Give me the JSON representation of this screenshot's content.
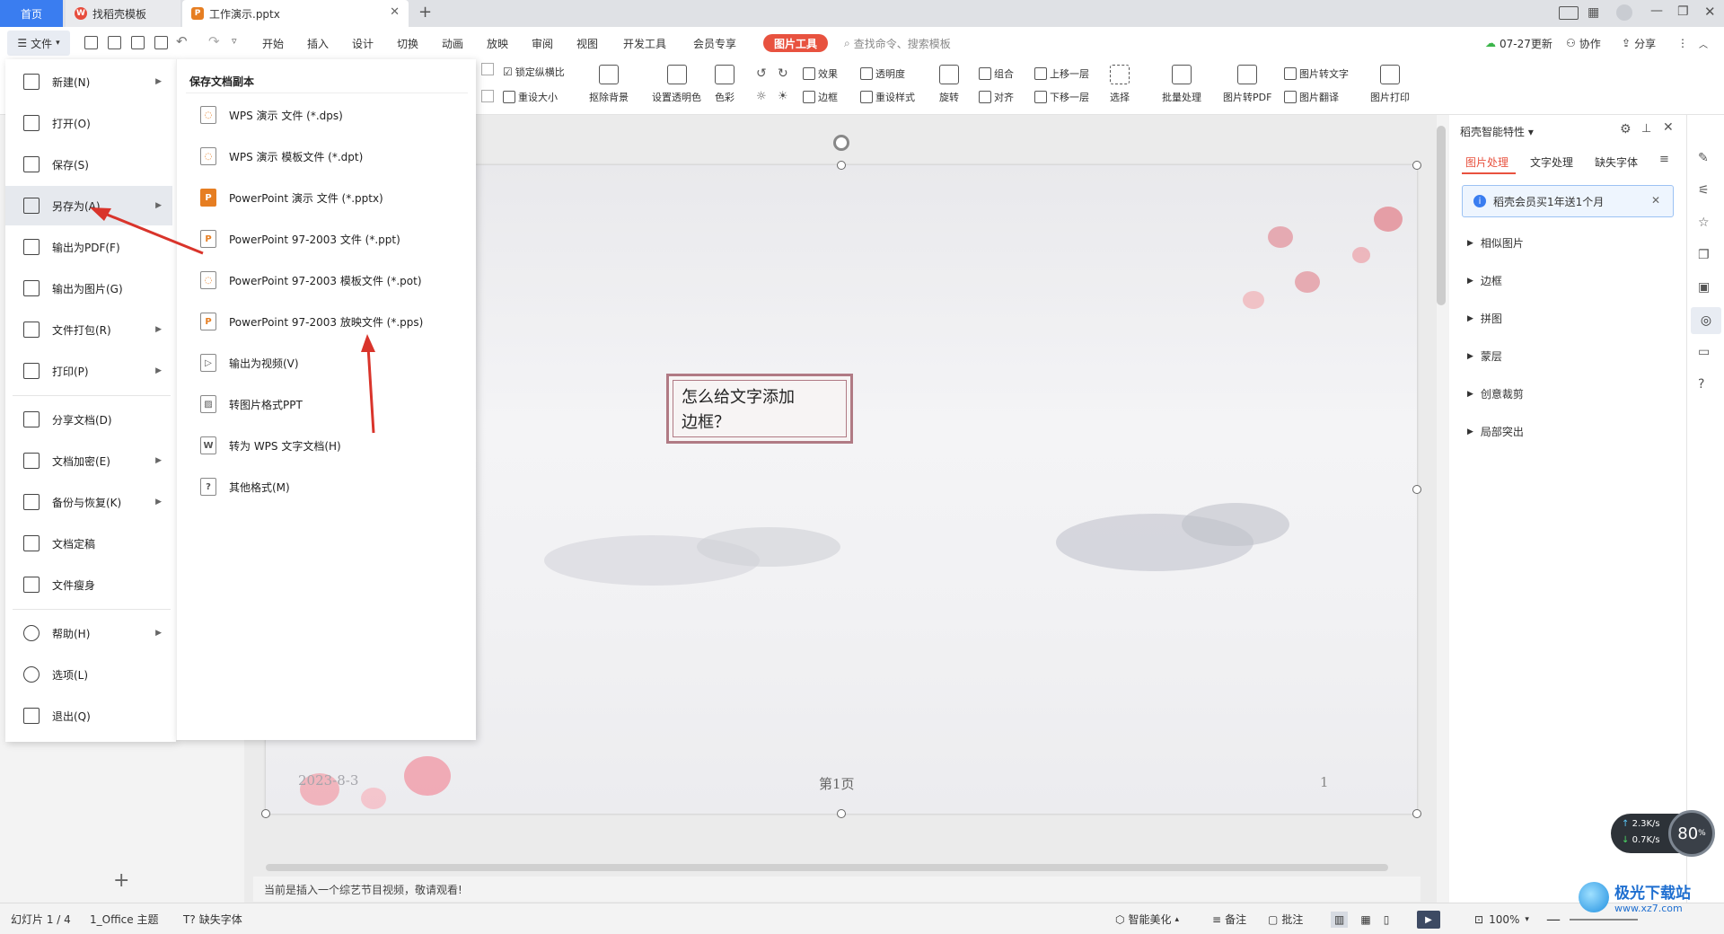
{
  "tabs": {
    "home": "首页",
    "template": "找稻壳模板",
    "document": "工作演示.pptx"
  },
  "menubar": {
    "file": "文件",
    "items": [
      "开始",
      "插入",
      "设计",
      "切换",
      "动画",
      "放映",
      "审阅",
      "视图",
      "开发工具",
      "会员专享"
    ],
    "picture_tool": "图片工具",
    "search_placeholder": "查找命令、搜索模板",
    "update": "07-27更新",
    "collab": "协作",
    "share": "分享"
  },
  "ribbon": {
    "lock_ratio": "锁定纵横比",
    "reset_size": "重设大小",
    "remove_bg": "抠除背景",
    "set_transparent": "设置透明色",
    "color": "色彩",
    "effect": "效果",
    "transparency": "透明度",
    "border": "边框",
    "reset_style": "重设样式",
    "rotate": "旋转",
    "group": "组合",
    "align": "对齐",
    "bring_forward": "上移一层",
    "send_backward": "下移一层",
    "select": "选择",
    "batch": "批量处理",
    "pic_to_pdf": "图片转PDF",
    "pic_to_text": "图片转文字",
    "pic_translate": "图片翻译",
    "pic_print": "图片打印"
  },
  "file_menu": {
    "items": [
      {
        "label": "新建(N)",
        "arrow": true
      },
      {
        "label": "打开(O)",
        "arrow": false
      },
      {
        "label": "保存(S)",
        "arrow": false
      },
      {
        "label": "另存为(A)",
        "arrow": true
      },
      {
        "label": "输出为PDF(F)",
        "arrow": false
      },
      {
        "label": "输出为图片(G)",
        "arrow": false
      },
      {
        "label": "文件打包(R)",
        "arrow": true
      },
      {
        "label": "打印(P)",
        "arrow": true
      },
      {
        "label": "分享文档(D)",
        "arrow": false
      },
      {
        "label": "文档加密(E)",
        "arrow": true
      },
      {
        "label": "备份与恢复(K)",
        "arrow": true
      },
      {
        "label": "文档定稿",
        "arrow": false
      },
      {
        "label": "文件瘦身",
        "arrow": false
      },
      {
        "label": "帮助(H)",
        "arrow": true
      },
      {
        "label": "选项(L)",
        "arrow": false
      },
      {
        "label": "退出(Q)",
        "arrow": false
      }
    ],
    "submenu_title": "保存文档副本",
    "submenu": [
      "WPS 演示 文件 (*.dps)",
      "WPS 演示 模板文件 (*.dpt)",
      "PowerPoint 演示 文件 (*.pptx)",
      "PowerPoint 97-2003 文件 (*.ppt)",
      "PowerPoint 97-2003 模板文件 (*.pot)",
      "PowerPoint 97-2003 放映文件 (*.pps)",
      "输出为视频(V)",
      "转图片格式PPT",
      "转为 WPS 文字文档(H)",
      "其他格式(M)"
    ]
  },
  "slide": {
    "text_line1": "怎么给文字添加",
    "text_line2": "边框？",
    "date": "2023-8-3",
    "page_label": "第1页",
    "page_number": "1"
  },
  "notes": "当前是插入一个综艺节目视频，敬请观看!",
  "right_panel": {
    "title": "稻壳智能特性",
    "tabs": [
      "图片处理",
      "文字处理",
      "缺失字体"
    ],
    "promo": "稻壳会员买1年送1个月",
    "sections": [
      "相似图片",
      "边框",
      "拼图",
      "蒙层",
      "创意裁剪",
      "局部突出"
    ]
  },
  "status": {
    "slide": "幻灯片 1 / 4",
    "theme": "1_Office 主题",
    "missing_font": "缺失字体",
    "beautify": "智能美化",
    "notes": "备注",
    "comment": "批注",
    "zoom": "100%",
    "net_up": "2.3",
    "net_down": "0.7",
    "net_unit": "K/s",
    "cpu": "80",
    "cpu_unit": "%"
  },
  "watermark": {
    "site": "极光下载站",
    "url": "www.xz7.com"
  },
  "colors": {
    "accent": "#3a7df0",
    "picture_tool": "#e8523f",
    "arrow": "#d9342b",
    "frame": "#b07a84"
  }
}
